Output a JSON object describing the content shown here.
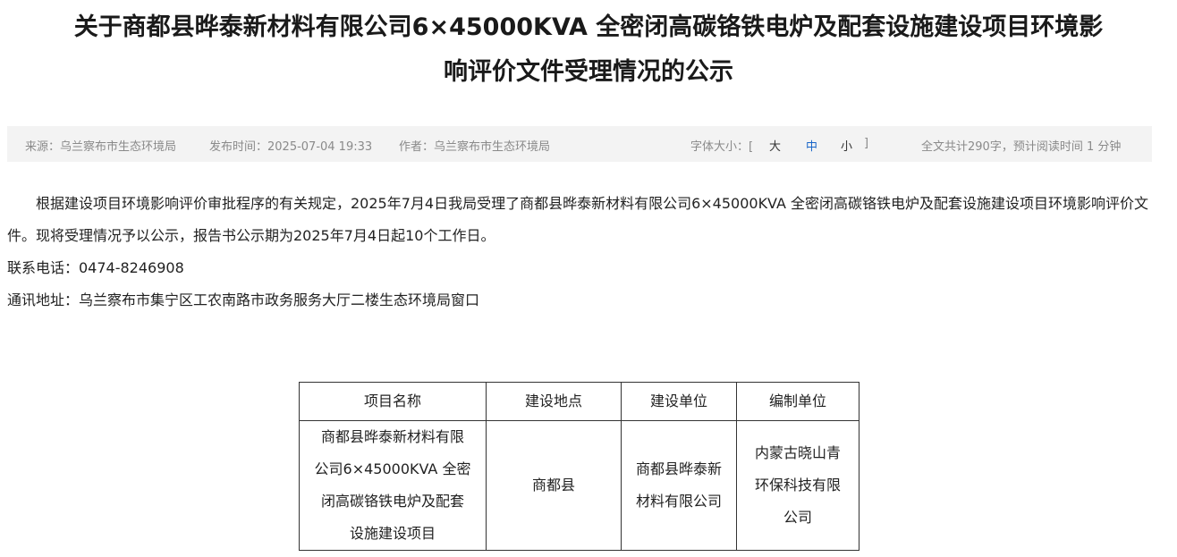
{
  "title": {
    "line1": "关于商都县晔泰新材料有限公司6×45000KVA 全密闭高碳铬铁电炉及配套设施建设项目环境影",
    "line2": "响评价文件受理情况的公示"
  },
  "meta": {
    "source": "来源：乌兰察布市生态环境局",
    "publish_time": "发布时间：2025-07-04 19:33",
    "author": "作者：乌兰察布市生态环境局",
    "font_size_label": "字体大小：[",
    "font_size_options": [
      "大",
      "中",
      "小"
    ],
    "font_size_close": "]",
    "reading_info": "全文共计290字，预计阅读时间 1 分钟"
  },
  "content": {
    "paragraph": "根据建设项目环境影响评价审批程序的有关规定，2025年7月4日我局受理了商都县晔泰新材料有限公司6×45000KVA 全密闭高碳铬铁电炉及配套设施建设项目环境影响评价文件。现将受理情况予以公示，报告书公示期为2025年7月4日起10个工作日。",
    "phone": "联系电话：0474-8246908",
    "address": "通讯地址：乌兰察布市集宁区工农南路市政务服务大厅二楼生态环境局窗口"
  },
  "table": {
    "headers": [
      "项目名称",
      "建设地点",
      "建设单位",
      "编制单位"
    ],
    "rows": [
      {
        "project_name_lines": [
          "商都县晔泰新材料有限",
          "公司6×45000KVA 全密",
          "闭高碳铬铁电炉及配套",
          "设施建设项目"
        ],
        "location": "商都县",
        "builder_lines": [
          "商都县晔泰新",
          "材料有限公司"
        ],
        "compiler_lines": [
          "内蒙古晓山青",
          "环保科技有限",
          "公司"
        ]
      }
    ]
  }
}
